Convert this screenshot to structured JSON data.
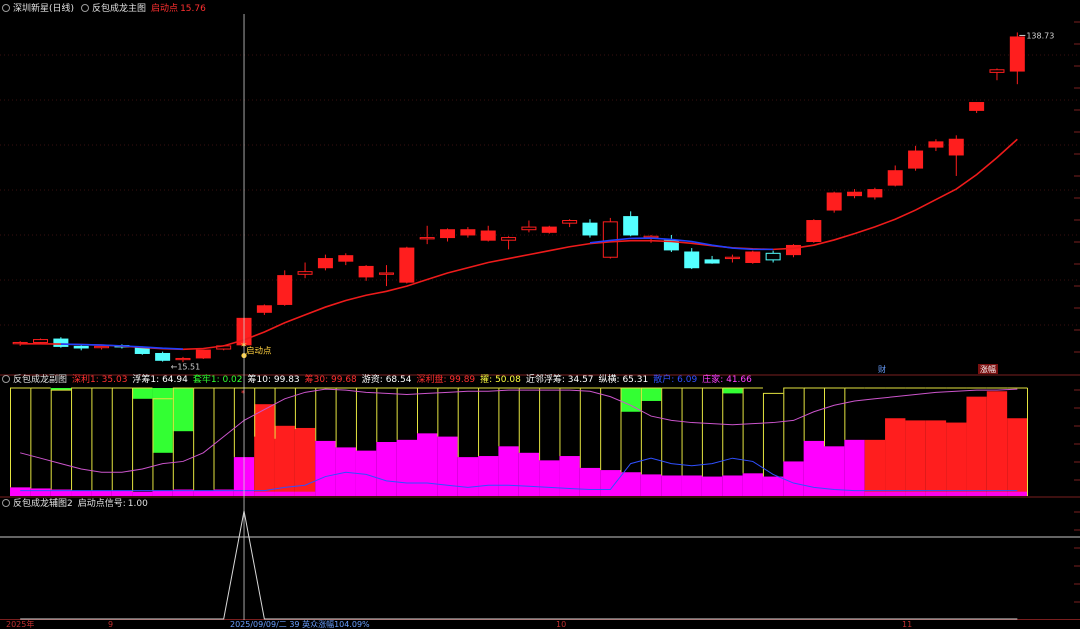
{
  "header_main": {
    "stock": "深圳新星(日线)",
    "indicator": "反包成龙主图",
    "start_label": "启动点",
    "start_value": "15.76"
  },
  "header_sub1": {
    "indicator": "反包成龙副图",
    "items": [
      {
        "label": "深利1",
        "value": "35.03",
        "color": "#ff3030"
      },
      {
        "label": "浮筹1",
        "value": "64.94",
        "color": "#ffffff"
      },
      {
        "label": "套牢1",
        "value": "0.02",
        "color": "#30ff30"
      },
      {
        "label": "筹10",
        "value": "99.83",
        "color": "#ffffff"
      },
      {
        "label": "筹30",
        "value": "99.68",
        "color": "#ff3030"
      },
      {
        "label": "游资",
        "value": "68.54",
        "color": "#ffffff"
      },
      {
        "label": "深利盘",
        "value": "99.89",
        "color": "#ff3030"
      },
      {
        "label": "擢",
        "value": "50.08",
        "color": "#ffff40"
      },
      {
        "label": "近邻浮筹",
        "value": "34.57",
        "color": "#ffffff"
      },
      {
        "label": "纵横",
        "value": "65.31",
        "color": "#ffffff"
      },
      {
        "label": "散户",
        "value": "6.09",
        "color": "#3050ff"
      },
      {
        "label": "庄家",
        "value": "41.66",
        "color": "#ff40ff"
      }
    ]
  },
  "header_sub2": {
    "indicator": "反包成龙辅图2",
    "label": "启动点信号",
    "value": "1.00"
  },
  "annotations": {
    "high_label": "138.73",
    "low_label": "15.51",
    "start_marker": "启动点",
    "event_cai": "财",
    "event_zhangting": "涨幅"
  },
  "x_axis": {
    "labels": [
      {
        "text": "2025年",
        "color": "#c03030"
      },
      {
        "text": "9",
        "color": "#c03030"
      },
      {
        "text": "2025/09/09/二 39 英众涨幅104.09%",
        "color": "#6aa0ff"
      },
      {
        "text": "10",
        "color": "#c03030"
      },
      {
        "text": "11",
        "color": "#c03030"
      }
    ]
  },
  "colors": {
    "up": "#ff1e1e",
    "down": "#54ffff",
    "ma_red": "#ee1b1b",
    "ma_blue": "#2040ff",
    "magenta": "#ff00ff",
    "green": "#33ff33",
    "yellow": "#e5e540",
    "purple_line": "#cc55cc",
    "cursor": "#d0d0d0"
  },
  "chart_data": [
    {
      "type": "candlestick",
      "title": "反包成龙主图",
      "ylim": [
        10,
        145
      ],
      "candles": [
        {
          "o": 20.0,
          "h": 21.0,
          "l": 19.2,
          "c": 20.5,
          "dir": "up"
        },
        {
          "o": 20.5,
          "h": 22.0,
          "l": 20.0,
          "c": 21.6,
          "dir": "up"
        },
        {
          "o": 21.8,
          "h": 22.5,
          "l": 18.5,
          "c": 19.0,
          "dir": "down"
        },
        {
          "o": 19.0,
          "h": 19.8,
          "l": 17.5,
          "c": 18.4,
          "dir": "down"
        },
        {
          "o": 18.5,
          "h": 19.5,
          "l": 17.8,
          "c": 19.0,
          "dir": "up"
        },
        {
          "o": 19.3,
          "h": 19.8,
          "l": 18.2,
          "c": 18.8,
          "dir": "down"
        },
        {
          "o": 18.5,
          "h": 19.0,
          "l": 15.8,
          "c": 16.3,
          "dir": "down"
        },
        {
          "o": 16.3,
          "h": 17.0,
          "l": 13.2,
          "c": 13.7,
          "dir": "down"
        },
        {
          "o": 14.0,
          "h": 15.0,
          "l": 13.0,
          "c": 14.4,
          "dir": "up"
        },
        {
          "o": 14.6,
          "h": 17.6,
          "l": 14.2,
          "c": 17.6,
          "dir": "up"
        },
        {
          "o": 18.0,
          "h": 19.5,
          "l": 17.5,
          "c": 19.2,
          "dir": "up"
        },
        {
          "o": 19.6,
          "h": 29.7,
          "l": 19.0,
          "c": 29.7,
          "dir": "up"
        },
        {
          "o": 32.0,
          "h": 35.0,
          "l": 31.0,
          "c": 34.5,
          "dir": "up"
        },
        {
          "o": 35.0,
          "h": 48.0,
          "l": 34.5,
          "c": 46.0,
          "dir": "up"
        },
        {
          "o": 46.5,
          "h": 51.0,
          "l": 45.0,
          "c": 47.5,
          "dir": "up"
        },
        {
          "o": 49.0,
          "h": 54.0,
          "l": 48.0,
          "c": 52.5,
          "dir": "up"
        },
        {
          "o": 51.5,
          "h": 54.5,
          "l": 50.0,
          "c": 53.6,
          "dir": "up"
        },
        {
          "o": 45.5,
          "h": 50.0,
          "l": 44.0,
          "c": 49.5,
          "dir": "up"
        },
        {
          "o": 47.0,
          "h": 50.0,
          "l": 42.0,
          "c": 46.5,
          "dir": "up"
        },
        {
          "o": 43.5,
          "h": 57.0,
          "l": 43.0,
          "c": 56.5,
          "dir": "up"
        },
        {
          "o": 60.0,
          "h": 65.0,
          "l": 58.0,
          "c": 60.5,
          "dir": "up"
        },
        {
          "o": 60.5,
          "h": 64.0,
          "l": 59.0,
          "c": 63.5,
          "dir": "up"
        },
        {
          "o": 61.5,
          "h": 64.5,
          "l": 60.5,
          "c": 63.5,
          "dir": "up"
        },
        {
          "o": 59.5,
          "h": 65.0,
          "l": 59.0,
          "c": 63.0,
          "dir": "up"
        },
        {
          "o": 59.5,
          "h": 61.0,
          "l": 56.0,
          "c": 60.5,
          "dir": "up"
        },
        {
          "o": 63.5,
          "h": 67.0,
          "l": 62.5,
          "c": 64.5,
          "dir": "up"
        },
        {
          "o": 62.5,
          "h": 65.0,
          "l": 62.0,
          "c": 64.5,
          "dir": "up"
        },
        {
          "o": 66.0,
          "h": 67.5,
          "l": 64.5,
          "c": 67.0,
          "dir": "up"
        },
        {
          "o": 66.0,
          "h": 67.5,
          "l": 60.5,
          "c": 61.5,
          "dir": "down"
        },
        {
          "o": 53.0,
          "h": 68.0,
          "l": 52.5,
          "c": 66.5,
          "dir": "up"
        },
        {
          "o": 68.5,
          "h": 70.5,
          "l": 61.0,
          "c": 61.5,
          "dir": "down"
        },
        {
          "o": 60.5,
          "h": 61.5,
          "l": 58.5,
          "c": 61.0,
          "dir": "up"
        },
        {
          "o": 59.5,
          "h": 61.5,
          "l": 55.0,
          "c": 55.8,
          "dir": "down"
        },
        {
          "o": 55.0,
          "h": 56.5,
          "l": 48.5,
          "c": 49.0,
          "dir": "down"
        },
        {
          "o": 52.0,
          "h": 53.5,
          "l": 50.5,
          "c": 50.8,
          "dir": "down"
        },
        {
          "o": 52.5,
          "h": 54.0,
          "l": 51.0,
          "c": 53.0,
          "dir": "up"
        },
        {
          "o": 51.0,
          "h": 55.5,
          "l": 50.5,
          "c": 55.0,
          "dir": "up"
        },
        {
          "o": 54.5,
          "h": 55.5,
          "l": 51.0,
          "c": 52.0,
          "dir": "down"
        },
        {
          "o": 54.0,
          "h": 58.0,
          "l": 53.0,
          "c": 57.5,
          "dir": "up"
        },
        {
          "o": 59.0,
          "h": 67.5,
          "l": 58.5,
          "c": 67.0,
          "dir": "up"
        },
        {
          "o": 71.0,
          "h": 78.0,
          "l": 70.0,
          "c": 77.5,
          "dir": "up"
        },
        {
          "o": 76.5,
          "h": 79.0,
          "l": 75.5,
          "c": 77.8,
          "dir": "up"
        },
        {
          "o": 76.0,
          "h": 79.5,
          "l": 75.0,
          "c": 78.8,
          "dir": "up"
        },
        {
          "o": 80.5,
          "h": 88.0,
          "l": 80.0,
          "c": 86.0,
          "dir": "up"
        },
        {
          "o": 87.0,
          "h": 95.5,
          "l": 86.0,
          "c": 93.5,
          "dir": "up"
        },
        {
          "o": 95.0,
          "h": 98.0,
          "l": 93.5,
          "c": 97.0,
          "dir": "up"
        },
        {
          "o": 92.0,
          "h": 99.5,
          "l": 84.0,
          "c": 98.0,
          "dir": "up"
        },
        {
          "o": 109.0,
          "h": 112.0,
          "l": 108.0,
          "c": 112.0,
          "dir": "up"
        },
        {
          "o": 123.5,
          "h": 125.0,
          "l": 120.5,
          "c": 124.5,
          "dir": "up"
        },
        {
          "o": 124.0,
          "h": 138.73,
          "l": 119.0,
          "c": 137.0,
          "dir": "up"
        }
      ],
      "ma_red": [
        20.0,
        20.0,
        19.9,
        19.7,
        19.5,
        19.1,
        18.6,
        18.1,
        17.9,
        18.2,
        19.2,
        21.5,
        24.5,
        28.0,
        31.0,
        34.0,
        36.5,
        38.5,
        40.0,
        42.0,
        44.5,
        47.0,
        49.0,
        51.0,
        52.5,
        54.0,
        55.5,
        57.0,
        58.2,
        58.9,
        59.3,
        59.3,
        59.0,
        58.3,
        57.4,
        56.6,
        56.2,
        56.0,
        56.4,
        57.6,
        59.6,
        62.0,
        64.6,
        67.5,
        71.0,
        75.0,
        79.0,
        84.5,
        91.0,
        98.0
      ],
      "ma_blue": [
        20.0,
        20.0,
        19.9,
        19.7,
        19.5,
        19.2,
        18.8,
        18.3,
        18.0,
        18.2,
        19.0,
        21.5,
        24.5,
        28.0,
        31.0,
        34.0,
        36.5,
        38.5,
        40.0,
        42.0,
        44.5,
        47.0,
        49.0,
        51.0,
        52.5,
        54.0,
        55.5,
        57.0,
        58.5,
        59.4,
        60.2,
        60.3,
        59.8,
        59.0,
        57.6,
        56.5,
        56.0,
        56.0,
        56.4,
        57.6,
        59.6,
        62.0,
        64.6,
        67.5,
        71.0,
        75.0,
        79.0,
        84.5,
        91.0,
        98.0
      ],
      "ma_blue_active": [
        false,
        false,
        true,
        true,
        true,
        true,
        true,
        true,
        true,
        false,
        false,
        false,
        false,
        false,
        false,
        false,
        false,
        false,
        false,
        false,
        false,
        false,
        false,
        false,
        false,
        false,
        false,
        false,
        true,
        true,
        true,
        true,
        true,
        true,
        true,
        true,
        true,
        true,
        false,
        false,
        false,
        false,
        false,
        false,
        false,
        false,
        false,
        false,
        false,
        false
      ]
    },
    {
      "type": "bar",
      "title": "反包成龙副图",
      "ylim": [
        0,
        100
      ],
      "bar_base": [
        8,
        7,
        6,
        5,
        5,
        5,
        4,
        5,
        6,
        5,
        6,
        36,
        55,
        53,
        62,
        51,
        45,
        42,
        50,
        52,
        58,
        55,
        36,
        37,
        46,
        40,
        33,
        37,
        26,
        24,
        22,
        20,
        19,
        19,
        18,
        19,
        21,
        18,
        32,
        51,
        46,
        52,
        100,
        100,
        100,
        100,
        100,
        100,
        100,
        100
      ],
      "bar_base_color": [
        "m",
        "m",
        "m",
        "m",
        "m",
        "m",
        "m",
        "m",
        "m",
        "m",
        "m",
        "m",
        "r",
        "r",
        "r",
        "m",
        "m",
        "m",
        "m",
        "m",
        "m",
        "m",
        "m",
        "m",
        "m",
        "m",
        "m",
        "m",
        "m",
        "m",
        "m",
        "m",
        "m",
        "m",
        "m",
        "m",
        "m",
        "m",
        "m",
        "m",
        "m",
        "m",
        "r",
        "r",
        "r",
        "r",
        "r",
        "r",
        "r",
        "r"
      ],
      "bar_top": [
        100,
        100,
        98,
        100,
        100,
        100,
        100,
        90,
        100,
        100,
        100,
        100,
        100,
        100,
        100,
        100,
        100,
        100,
        100,
        100,
        100,
        100,
        100,
        100,
        100,
        100,
        100,
        100,
        100,
        100,
        100,
        100,
        100,
        100,
        100,
        100,
        100,
        95,
        100,
        100,
        100,
        100,
        100,
        100,
        100,
        100,
        100,
        100,
        100,
        100
      ],
      "green_cap": [
        0,
        0,
        2,
        0,
        0,
        0,
        10,
        60,
        40,
        0,
        0,
        0,
        0,
        0,
        0,
        0,
        0,
        0,
        0,
        0,
        0,
        0,
        0,
        0,
        0,
        0,
        0,
        0,
        0,
        0,
        22,
        12,
        0,
        0,
        0,
        5,
        0,
        0,
        0,
        0,
        0,
        0,
        0,
        0,
        0,
        0,
        0,
        0,
        0,
        0
      ],
      "filled_red": [
        0,
        0,
        0,
        0,
        0,
        0,
        0,
        0,
        0,
        0,
        0,
        0,
        85,
        65,
        63,
        0,
        0,
        0,
        0,
        0,
        0,
        0,
        0,
        0,
        0,
        0,
        0,
        0,
        0,
        0,
        0,
        0,
        0,
        0,
        0,
        0,
        0,
        0,
        0,
        0,
        0,
        0,
        52,
        72,
        70,
        70,
        68,
        92,
        97,
        72
      ],
      "purple_line": [
        40,
        35,
        30,
        25,
        22,
        22,
        25,
        30,
        32,
        40,
        55,
        70,
        80,
        90,
        96,
        99,
        98,
        96,
        95,
        94,
        95,
        96,
        97,
        97,
        98,
        98,
        98,
        98,
        97,
        92,
        84,
        74,
        70,
        68,
        67,
        66,
        67,
        68,
        70,
        78,
        84,
        88,
        90,
        92,
        94,
        96,
        97,
        98,
        98,
        99
      ],
      "blue_line": [
        5,
        5,
        5,
        5,
        5,
        5,
        5,
        5,
        5,
        5,
        5,
        5,
        5,
        8,
        10,
        18,
        22,
        20,
        14,
        12,
        12,
        10,
        8,
        10,
        10,
        9,
        8,
        7,
        6,
        6,
        30,
        35,
        30,
        28,
        30,
        35,
        32,
        20,
        12,
        8,
        6,
        5,
        5,
        5,
        5,
        5,
        5,
        5,
        5,
        5
      ]
    },
    {
      "type": "line",
      "title": "反包成龙辅图2",
      "series": [
        {
          "name": "启动点信号",
          "values": [
            0,
            0,
            0,
            0,
            0,
            0,
            0,
            0,
            0,
            0,
            0,
            1,
            0,
            0,
            0,
            0,
            0,
            0,
            0,
            0,
            0,
            0,
            0,
            0,
            0,
            0,
            0,
            0,
            0,
            0,
            0,
            0,
            0,
            0,
            0,
            0,
            0,
            0,
            0,
            0,
            0,
            0,
            0,
            0,
            0,
            0,
            0,
            0,
            0,
            0
          ]
        }
      ],
      "ylim": [
        0,
        1
      ]
    }
  ]
}
